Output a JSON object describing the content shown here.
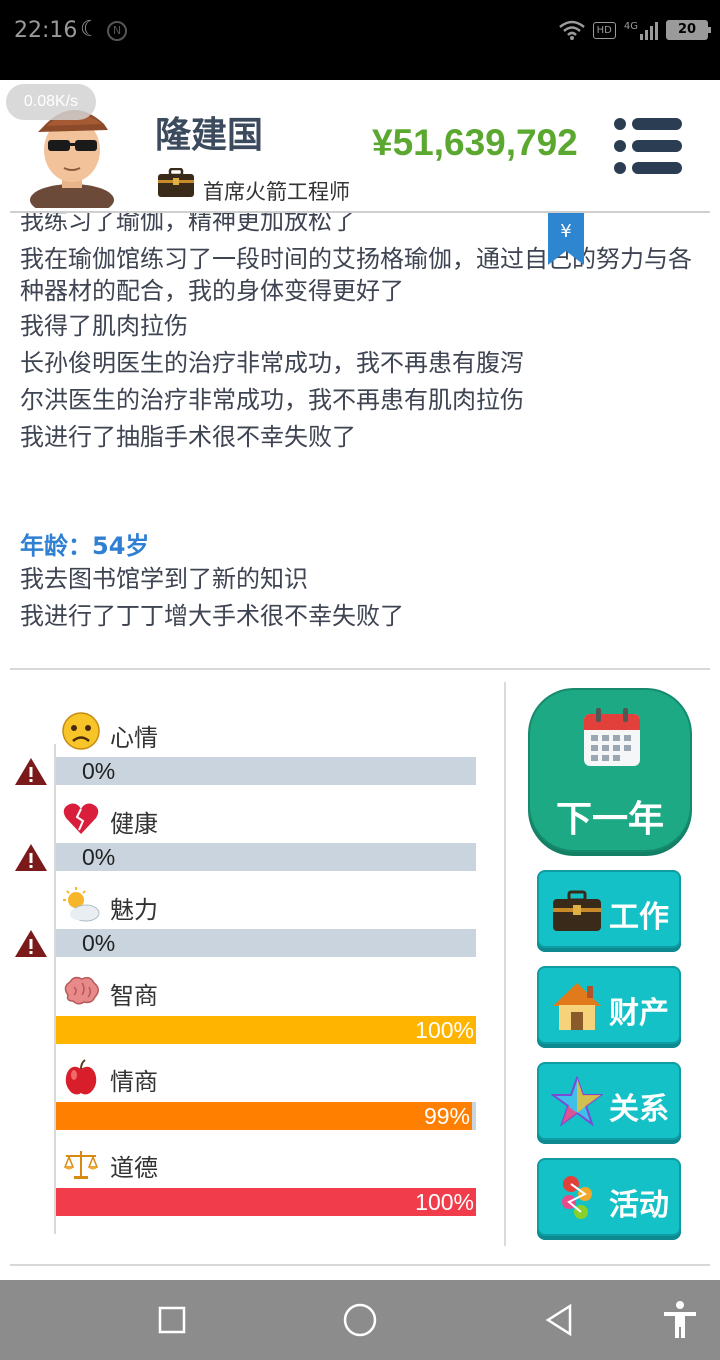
{
  "status_bar": {
    "time": "22:16",
    "hd": "HD",
    "network": "4G",
    "battery": "20"
  },
  "speed_badge": "0.08K/s",
  "header": {
    "player_name": "隆建国",
    "job_title": "首席火箭工程师",
    "money": "¥51,639,792"
  },
  "log": {
    "bookmark_symbol": "¥",
    "lines": [
      "我练习了瑜伽，精神更加放松了",
      "我在瑜伽馆练习了一段时间的艾扬格瑜伽，通过自己的努力与各种器材的配合，我的身体变得更好了",
      "我得了肌肉拉伤",
      "长孙俊明医生的治疗非常成功，我不再患有腹泻",
      "尔洪医生的治疗非常成功，我不再患有肌肉拉伤",
      "我进行了抽脂手术很不幸失败了"
    ],
    "age_label": "年龄：54岁",
    "age_lines": [
      "我去图书馆学到了新的知识",
      "我进行了丁丁增大手术很不幸失败了"
    ]
  },
  "stats": [
    {
      "label": "心情",
      "value": 0,
      "display": "0%",
      "color": "#c9d4de",
      "icon": "sad-face-icon",
      "warning": true
    },
    {
      "label": "健康",
      "value": 0,
      "display": "0%",
      "color": "#c9d4de",
      "icon": "broken-heart-icon",
      "warning": true
    },
    {
      "label": "魅力",
      "value": 0,
      "display": "0%",
      "color": "#c9d4de",
      "icon": "sun-cloud-icon",
      "warning": true
    },
    {
      "label": "智商",
      "value": 100,
      "display": "100%",
      "color": "#ffb400",
      "icon": "brain-icon",
      "warning": false
    },
    {
      "label": "情商",
      "value": 99,
      "display": "99%",
      "color": "#ff7f00",
      "icon": "apple-icon",
      "warning": false
    },
    {
      "label": "道德",
      "value": 100,
      "display": "100%",
      "color": "#f03c4b",
      "icon": "scale-icon",
      "warning": false
    }
  ],
  "actions": {
    "next_year": "下一年",
    "work": "工作",
    "assets": "财产",
    "relations": "关系",
    "activities": "活动"
  },
  "colors": {
    "money": "#5aa830",
    "age": "#2f7fd2",
    "next_year_bg": "#1ea985",
    "side_button_bg": "#14c1c6"
  }
}
